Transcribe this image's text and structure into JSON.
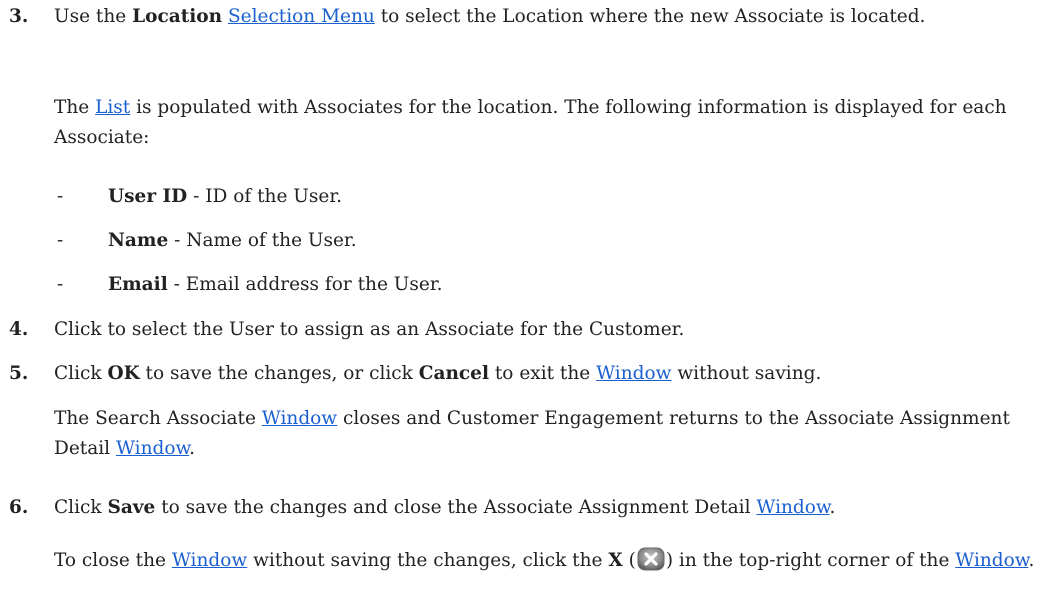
{
  "step3": {
    "number": "3.",
    "pre": "Use the ",
    "bold_location": "Location",
    "link_selection_menu": "Selection Menu",
    "post": " to select the Location where the new Associate is located."
  },
  "list_para": {
    "pre": "The ",
    "link_list": "List",
    "post": " is populated with Associates for the location. The following information is displayed for each Associate:"
  },
  "fields": [
    {
      "dash": "-",
      "label": "User ID",
      "desc": " - ID of the User."
    },
    {
      "dash": "-",
      "label": "Name",
      "desc": " - Name of the User."
    },
    {
      "dash": "-",
      "label": "Email",
      "desc": " - Email address for the User."
    }
  ],
  "step4": {
    "number": "4.",
    "text": "Click to select the User to assign as an Associate for the Customer."
  },
  "step5": {
    "number": "5.",
    "pre": "Click ",
    "bold_ok": "OK",
    "mid": " to save the changes, or click ",
    "bold_cancel": "Cancel",
    "mid2": " to exit the ",
    "link_window": "Window",
    "post": " without saving."
  },
  "closes_para": {
    "pre": "The Search Associate ",
    "link_window": "Window",
    "mid": " closes and Customer Engagement returns to the Associate Assignment Detail ",
    "link_window2": "Window",
    "post": "."
  },
  "step6": {
    "number": "6.",
    "pre": "Click ",
    "bold_save": "Save",
    "mid": " to save the changes and close the Associate Assignment Detail ",
    "link_window": "Window",
    "post": "."
  },
  "close_para": {
    "pre": "To close the ",
    "link_window": "Window",
    "mid": " without saving the changes, click the ",
    "bold_x": "X",
    "paren_open": " (",
    "icon": "close-x-icon",
    "paren_close": ")",
    "mid2": " in the top-right corner of the ",
    "link_window2": "Window",
    "post": "."
  }
}
